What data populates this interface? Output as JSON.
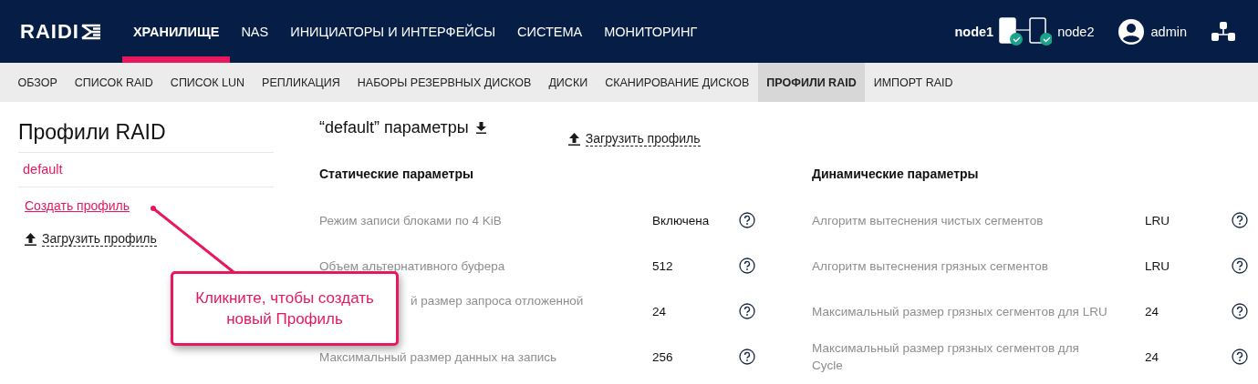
{
  "header": {
    "logo": "RAIDI",
    "nav": [
      {
        "label": "ХРАНИЛИЩЕ",
        "selected": true
      },
      {
        "label": "NAS",
        "selected": false
      },
      {
        "label": "ИНИЦИАТОРЫ И ИНТЕРФЕЙСЫ",
        "selected": false
      },
      {
        "label": "СИСТЕМА",
        "selected": false
      },
      {
        "label": "МОНИТОРИНГ",
        "selected": false
      }
    ],
    "nodes": [
      {
        "label": "node1",
        "ok": true,
        "current": true
      },
      {
        "label": "node2",
        "ok": true,
        "current": false
      }
    ],
    "user": "admin"
  },
  "subnav": [
    {
      "label": "ОБЗОР",
      "selected": false
    },
    {
      "label": "СПИСОК RAID",
      "selected": false
    },
    {
      "label": "СПИСОК LUN",
      "selected": false
    },
    {
      "label": "РЕПЛИКАЦИЯ",
      "selected": false
    },
    {
      "label": "НАБОРЫ РЕЗЕРВНЫХ ДИСКОВ",
      "selected": false
    },
    {
      "label": "ДИСКИ",
      "selected": false
    },
    {
      "label": "СКАНИРОВАНИЕ ДИСКОВ",
      "selected": false
    },
    {
      "label": "ПРОФИЛИ RAID",
      "selected": true
    },
    {
      "label": "ИМПОРТ RAID",
      "selected": false
    }
  ],
  "sidebar": {
    "title": "Профили RAID",
    "profiles": [
      {
        "label": "default",
        "selected": true
      }
    ],
    "create_link": "Создать профиль",
    "upload_link": "Загрузить профиль"
  },
  "main": {
    "title": "“default” параметры",
    "upload_link": "Загрузить профиль",
    "sections": [
      {
        "title": "Статические параметры",
        "params": [
          {
            "label": "Режим записи блоками по 4 KiB",
            "value": "Включена"
          },
          {
            "label": "Объем альтернативного буфера",
            "value": "512"
          },
          {
            "label": "й размер запроса отложенной",
            "value": "24",
            "partly_covered": true
          },
          {
            "label": "Максимальный размер данных на запись",
            "value": "256"
          }
        ]
      },
      {
        "title": "Динамические параметры",
        "params": [
          {
            "label": "Алгоритм вытеснения чистых сегментов",
            "value": "LRU"
          },
          {
            "label": "Алгоритм вытеснения грязных сегментов",
            "value": "LRU"
          },
          {
            "label": "Максимальный размер грязных сегментов для LRU",
            "value": "24"
          },
          {
            "label": "Максимальный размер грязных сегментов для Cycle",
            "value": "24"
          }
        ]
      }
    ]
  },
  "callout": {
    "text": "Кликните, чтобы создать новый Профиль"
  }
}
